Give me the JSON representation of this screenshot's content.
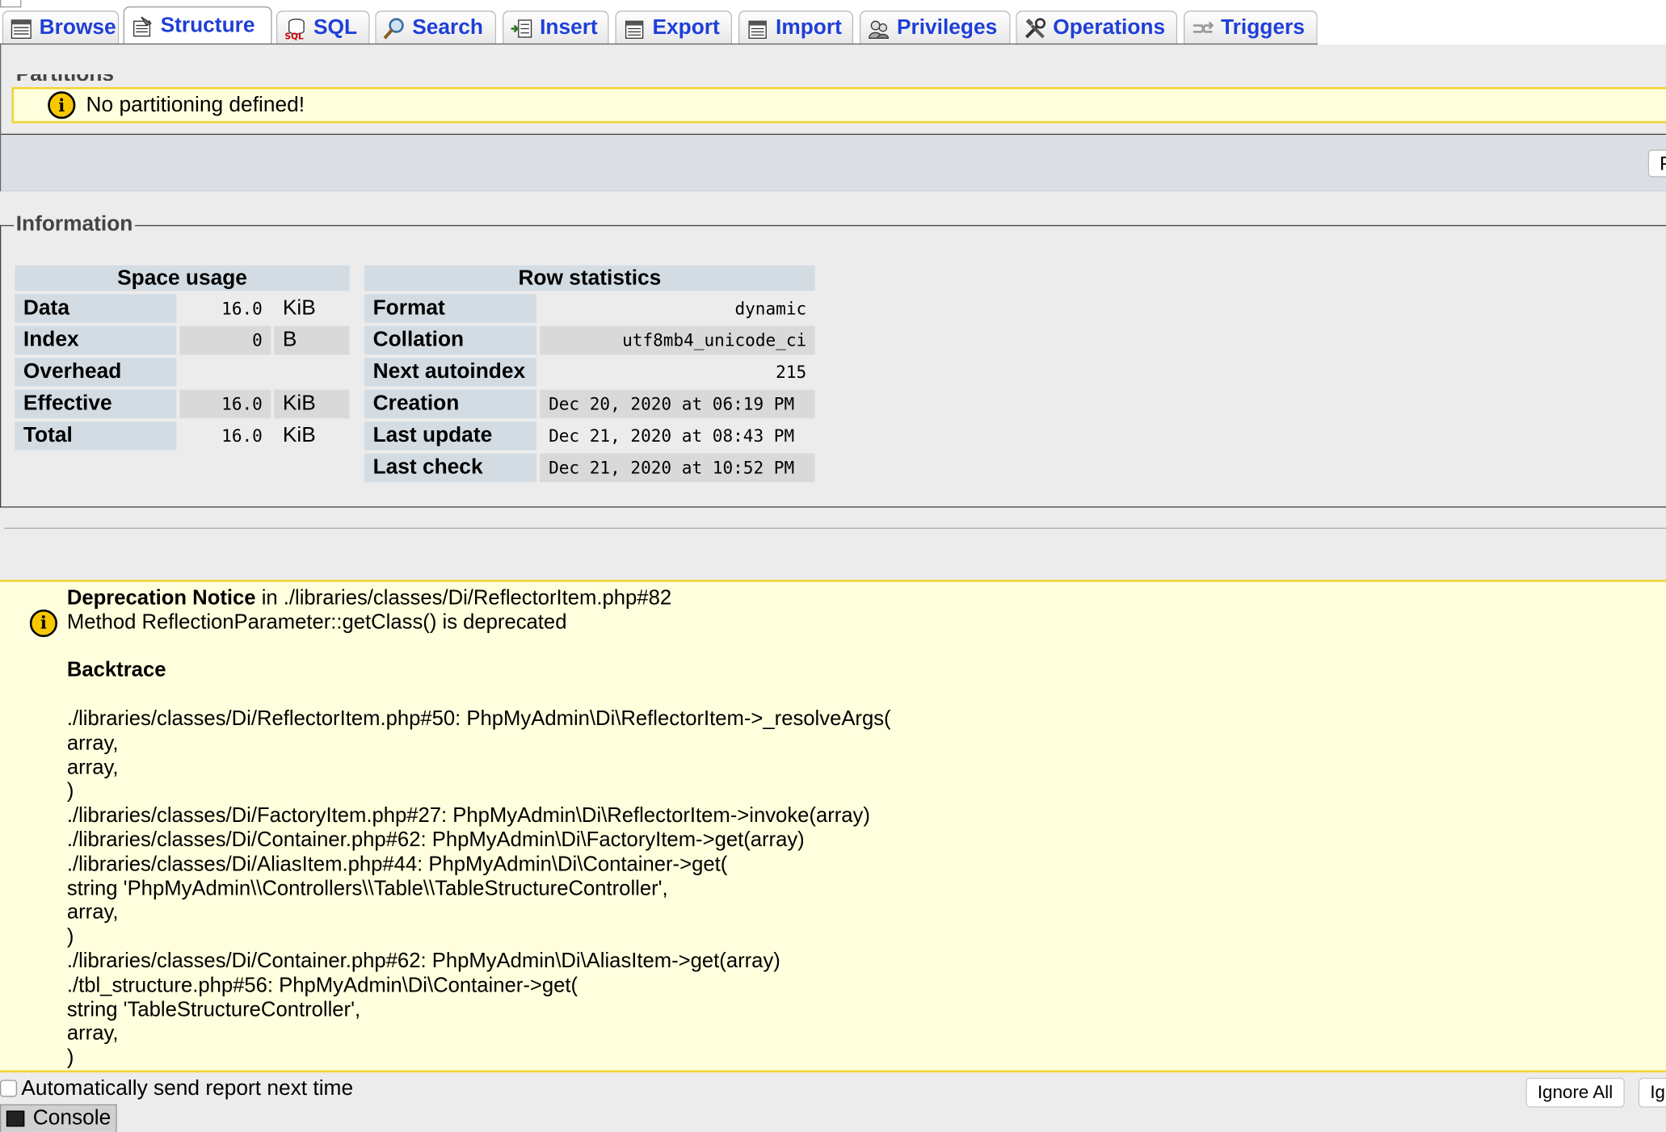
{
  "tabs": [
    {
      "label": "Browse",
      "icon": "browse-icon"
    },
    {
      "label": "Structure",
      "icon": "structure-icon",
      "active": true
    },
    {
      "label": "SQL",
      "icon": "sql-icon"
    },
    {
      "label": "Search",
      "icon": "search-icon"
    },
    {
      "label": "Insert",
      "icon": "insert-icon"
    },
    {
      "label": "Export",
      "icon": "export-icon"
    },
    {
      "label": "Import",
      "icon": "import-icon"
    },
    {
      "label": "Privileges",
      "icon": "privileges-icon"
    },
    {
      "label": "Operations",
      "icon": "operations-icon"
    },
    {
      "label": "Triggers",
      "icon": "triggers-icon"
    }
  ],
  "partitions": {
    "legend": "Partitions",
    "notice": "No partitioning defined!",
    "button_label": "P"
  },
  "information": {
    "legend": "Information",
    "space_usage": {
      "header": "Space usage",
      "rows": [
        {
          "label": "Data",
          "value": "16.0",
          "unit": "KiB"
        },
        {
          "label": "Index",
          "value": "0",
          "unit": "B"
        },
        {
          "label": "Overhead",
          "value": "",
          "unit": ""
        },
        {
          "label": "Effective",
          "value": "16.0",
          "unit": "KiB"
        },
        {
          "label": "Total",
          "value": "16.0",
          "unit": "KiB"
        }
      ]
    },
    "row_statistics": {
      "header": "Row statistics",
      "rows": [
        {
          "label": "Format",
          "value": "dynamic"
        },
        {
          "label": "Collation",
          "value": "utf8mb4_unicode_ci"
        },
        {
          "label": "Next autoindex",
          "value": "215"
        },
        {
          "label": "Creation",
          "value": "Dec 20, 2020 at 06:19 PM"
        },
        {
          "label": "Last update",
          "value": "Dec 21, 2020 at 08:43 PM"
        },
        {
          "label": "Last check",
          "value": "Dec 21, 2020 at 10:52 PM"
        }
      ]
    }
  },
  "error": {
    "title": "Deprecation Notice",
    "location": " in ./libraries/classes/Di/ReflectorItem.php#82",
    "message": "Method ReflectionParameter::getClass() is deprecated",
    "backtrace_heading": "Backtrace",
    "backtrace_lines": [
      "./libraries/classes/Di/ReflectorItem.php#50: PhpMyAdmin\\Di\\ReflectorItem->_resolveArgs(",
      "array,",
      "array,",
      ")",
      "./libraries/classes/Di/FactoryItem.php#27: PhpMyAdmin\\Di\\ReflectorItem->invoke(array)",
      "./libraries/classes/Di/Container.php#62: PhpMyAdmin\\Di\\FactoryItem->get(array)",
      "./libraries/classes/Di/AliasItem.php#44: PhpMyAdmin\\Di\\Container->get(",
      "string 'PhpMyAdmin\\\\Controllers\\\\Table\\\\TableStructureController',",
      "array,",
      ")",
      "./libraries/classes/Di/Container.php#62: PhpMyAdmin\\Di\\AliasItem->get(array)",
      "./tbl_structure.php#56: PhpMyAdmin\\Di\\Container->get(",
      "string 'TableStructureController',",
      "array,",
      ")"
    ]
  },
  "footer": {
    "auto_report_label": "Automatically send report next time",
    "ignore_all_label": "Ignore All",
    "ignore_label": "Ig",
    "console_label": "Console"
  }
}
